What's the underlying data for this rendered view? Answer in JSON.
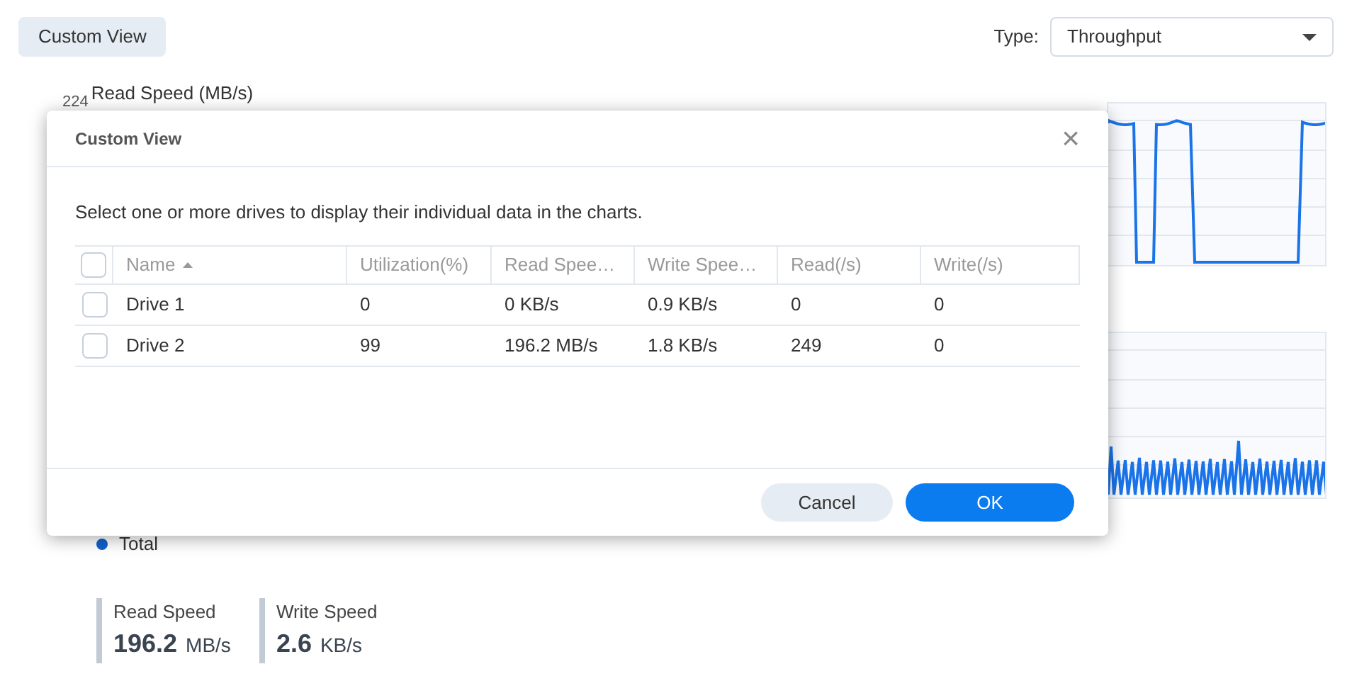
{
  "custom_view_button": "Custom View",
  "type_select": {
    "label": "Type:",
    "value": "Throughput"
  },
  "charts": [
    {
      "kind": "steps",
      "title": "Read Speed (MB/s)",
      "top_tick": "224"
    },
    {
      "kind": "spikes"
    }
  ],
  "legend": [
    {
      "label": "Total",
      "color": "#0f62cc"
    }
  ],
  "stats": [
    {
      "label": "Read Speed",
      "value": "196.2",
      "unit": "MB/s"
    },
    {
      "label": "Write Speed",
      "value": "2.6",
      "unit": "KB/s"
    }
  ],
  "dialog": {
    "title": "Custom View",
    "close": "×",
    "description": "Select one or more drives to display their individual data in the charts.",
    "select_all_checked": false,
    "columns": [
      {
        "label": "Name",
        "sorted": true
      },
      {
        "label": "Utilization(%)"
      },
      {
        "label": "Read Spee…"
      },
      {
        "label": "Write Spee…"
      },
      {
        "label": "Read(/s)"
      },
      {
        "label": "Write(/s)"
      }
    ],
    "rows": [
      {
        "checked": false,
        "cells": [
          "Drive 1",
          "0",
          "0 KB/s",
          "0.9 KB/s",
          "0",
          "0"
        ]
      },
      {
        "checked": false,
        "cells": [
          "Drive 2",
          "99",
          "196.2 MB/s",
          "1.8 KB/s",
          "249",
          "0"
        ]
      }
    ],
    "buttons": [
      {
        "label": "Cancel",
        "kind": "secondary"
      },
      {
        "label": "OK",
        "kind": "primary"
      }
    ]
  }
}
